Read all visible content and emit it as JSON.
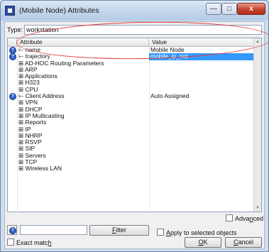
{
  "window": {
    "title": "(Mobile Node) Attributes",
    "minimize_glyph": "—",
    "maximize_glyph": "□",
    "close_glyph": "x"
  },
  "type": {
    "label": "Type:",
    "value": "workstation"
  },
  "table": {
    "headers": {
      "attribute": "Attribute",
      "value": "Value"
    },
    "rows": [
      {
        "help": true,
        "attribute": "name",
        "value": "Mobile Node",
        "selected": false
      },
      {
        "help": true,
        "attribute": "trajectory",
        "value": "mobile_ip_net",
        "selected": true
      },
      {
        "help": false,
        "attribute": "AD-HOC Routing Parameters",
        "value": "",
        "selected": false
      },
      {
        "help": false,
        "attribute": "ARP",
        "value": "",
        "selected": false
      },
      {
        "help": false,
        "attribute": "Applications",
        "value": "",
        "selected": false
      },
      {
        "help": false,
        "attribute": "H323",
        "value": "",
        "selected": false
      },
      {
        "help": false,
        "attribute": "CPU",
        "value": "",
        "selected": false
      },
      {
        "help": true,
        "attribute": "Client Address",
        "value": "Auto Assigned",
        "selected": false
      },
      {
        "help": false,
        "attribute": "VPN",
        "value": "",
        "selected": false
      },
      {
        "help": false,
        "attribute": "DHCP",
        "value": "",
        "selected": false
      },
      {
        "help": false,
        "attribute": "IP Multicasting",
        "value": "",
        "selected": false
      },
      {
        "help": false,
        "attribute": "Reports",
        "value": "",
        "selected": false
      },
      {
        "help": false,
        "attribute": "IP",
        "value": "",
        "selected": false
      },
      {
        "help": false,
        "attribute": "NHRP",
        "value": "",
        "selected": false
      },
      {
        "help": false,
        "attribute": "RSVP",
        "value": "",
        "selected": false
      },
      {
        "help": false,
        "attribute": "SIP",
        "value": "",
        "selected": false
      },
      {
        "help": false,
        "attribute": "Servers",
        "value": "",
        "selected": false
      },
      {
        "help": false,
        "attribute": "TCP",
        "value": "",
        "selected": false
      },
      {
        "help": false,
        "attribute": "Wireless LAN",
        "value": "",
        "selected": false
      }
    ]
  },
  "bottom": {
    "advanced_label": "Advanced",
    "filter_value": "",
    "filter_button": "Filter",
    "apply_label": "Apply to selected objects",
    "exact_match_label": "Exact match",
    "ok_button": "OK",
    "cancel_button": "Cancel"
  },
  "colors": {
    "highlight": "#3399ff",
    "annotation_ellipse": "#e23b3b",
    "help_icon": "#2a62c9"
  }
}
